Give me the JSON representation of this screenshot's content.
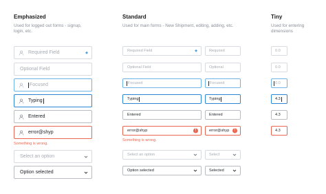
{
  "columns": {
    "emphasized": {
      "title": "Emphasized",
      "desc_line1": "Used for logged out forms - signup,",
      "desc_line2": "login, etc."
    },
    "standard": {
      "title": "Standard",
      "desc_line1": "Used for main forms - New Shipment, editing, adding, etc."
    },
    "tiny": {
      "title": "Tiny",
      "desc_line1": "Used for entering",
      "desc_line2": "dimensions"
    }
  },
  "emphasized": {
    "required": "Required Field",
    "optional": "Optional Field",
    "focused": "Focused",
    "typing": "Typing",
    "entered": "Entered",
    "error": "error@shyp",
    "error_msg": "Something is wrong.",
    "select_placeholder": "Select an option",
    "select_selected": "Option selected"
  },
  "standard": {
    "required": "Required Field",
    "optional": "Optional Field",
    "focused": "Focused",
    "typing": "Typing",
    "entered": "Entered",
    "error": "error@shyp",
    "error_msg": "Something is wrong.",
    "select_placeholder": "Select an option",
    "select_selected": "Option selected"
  },
  "standard_small": {
    "required": "Required",
    "optional": "Optional",
    "focused": "Focused",
    "typing": "Typing",
    "entered": "Entered",
    "error": "error@shyp",
    "select_placeholder": "Select",
    "select_selected": "Selected"
  },
  "tiny": {
    "required": "0.0",
    "optional": "0.0",
    "focused": "0.0",
    "typing": "4.3",
    "entered": "4.3",
    "error": "4.3"
  },
  "icons": {
    "user": "user-icon",
    "chevron": "chevron-down-icon",
    "error": "error-icon",
    "required_dot": "required-indicator-icon"
  },
  "colors": {
    "focus_border": "#6fb4e6",
    "typing_border": "#2c86d6",
    "error": "#e8664f",
    "placeholder": "#a7abb2",
    "description": "#8a8f98"
  }
}
